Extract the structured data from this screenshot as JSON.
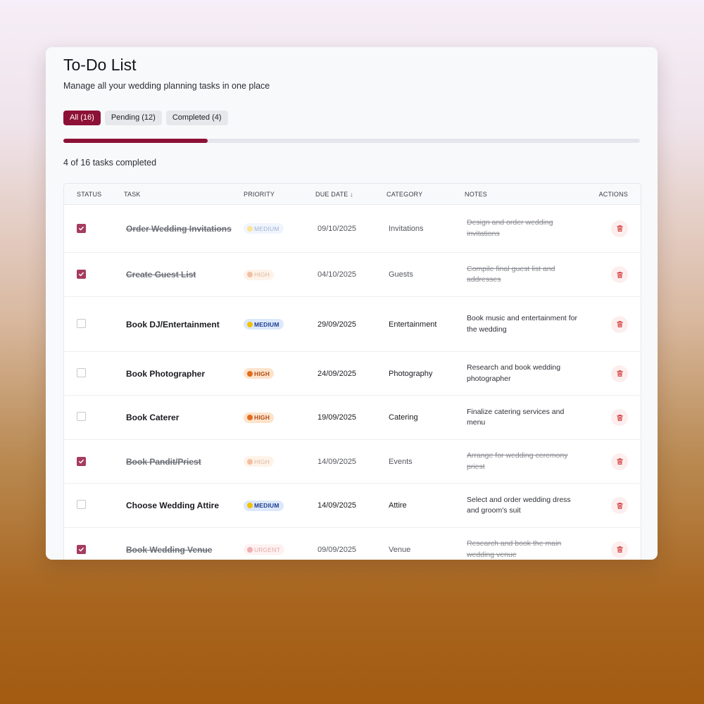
{
  "header": {
    "title": "To-Do List",
    "subtitle": "Manage all your wedding planning tasks in one place"
  },
  "filters": [
    {
      "label": "All (16)",
      "active": true
    },
    {
      "label": "Pending (12)",
      "active": false
    },
    {
      "label": "Completed (4)",
      "active": false
    }
  ],
  "progress": {
    "fraction": 0.25,
    "text": "4 of 16 tasks completed"
  },
  "table": {
    "columns": {
      "status": "STATUS",
      "task": "TASK",
      "priority": "PRIORITY",
      "due_date": "DUE DATE",
      "due_date_sort": "↓",
      "category": "CATEGORY",
      "notes": "NOTES",
      "actions": "ACTIONS"
    },
    "rows": [
      {
        "done": true,
        "task": "Order Wedding Invitations",
        "priority": "MEDIUM",
        "level": "medium",
        "due": "09/10/2025",
        "category": "Invitations",
        "notes": "Design and order wedding invitations"
      },
      {
        "done": true,
        "task": "Create Guest List",
        "priority": "HIGH",
        "level": "high",
        "due": "04/10/2025",
        "category": "Guests",
        "notes": "Compile final guest list and addresses"
      },
      {
        "done": false,
        "task": "Book DJ/Entertainment",
        "priority": "MEDIUM",
        "level": "medium",
        "due": "29/09/2025",
        "category": "Entertainment",
        "notes": "Book music and entertainment for the wedding"
      },
      {
        "done": false,
        "task": "Book Photographer",
        "priority": "HIGH",
        "level": "high",
        "due": "24/09/2025",
        "category": "Photography",
        "notes": "Research and book wedding photographer"
      },
      {
        "done": false,
        "task": "Book Caterer",
        "priority": "HIGH",
        "level": "high",
        "due": "19/09/2025",
        "category": "Catering",
        "notes": "Finalize catering services and menu"
      },
      {
        "done": true,
        "task": "Book Pandit/Priest",
        "priority": "HIGH",
        "level": "high",
        "due": "14/09/2025",
        "category": "Events",
        "notes": "Arrange for wedding ceremony priest"
      },
      {
        "done": false,
        "task": "Choose Wedding Attire",
        "priority": "MEDIUM",
        "level": "medium",
        "due": "14/09/2025",
        "category": "Attire",
        "notes": "Select and order wedding dress and groom's suit"
      },
      {
        "done": true,
        "task": "Book Wedding Venue",
        "priority": "URGENT",
        "level": "urgent",
        "due": "09/09/2025",
        "category": "Venue",
        "notes": "Research and book the main wedding venue"
      }
    ]
  },
  "icons": {
    "check": "check-icon",
    "trash": "trash-icon",
    "priority_dot": "priority-dot-icon"
  },
  "colors": {
    "accent": "#8d1136",
    "checked": "#a53c5e",
    "delete": "#d23a3a"
  }
}
